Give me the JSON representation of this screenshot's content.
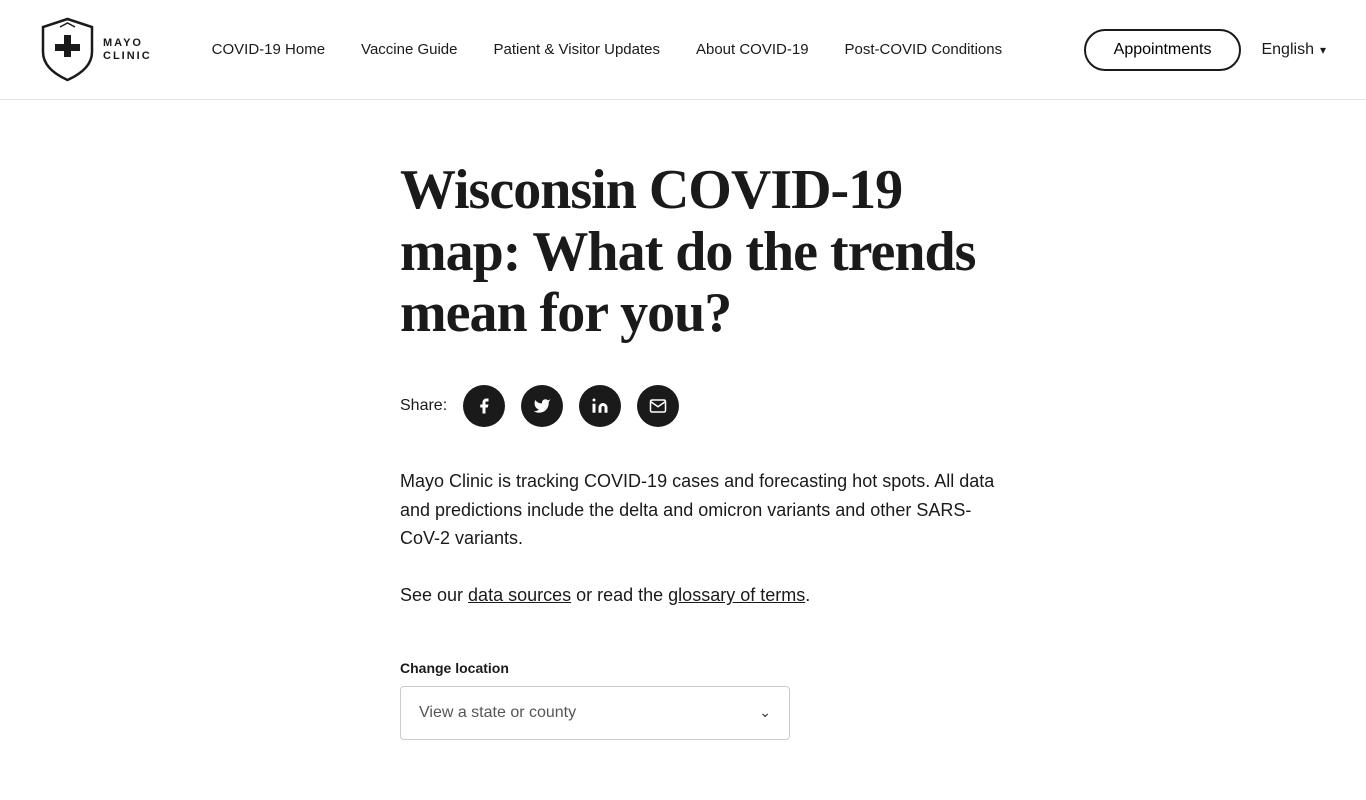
{
  "header": {
    "logo": {
      "line1": "MAYO",
      "line2": "CLINIC"
    },
    "nav": {
      "items": [
        {
          "label": "COVID-19 Home",
          "href": "#"
        },
        {
          "label": "Vaccine Guide",
          "href": "#"
        },
        {
          "label": "Patient & Visitor Updates",
          "href": "#"
        },
        {
          "label": "About COVID-19",
          "href": "#"
        },
        {
          "label": "Post-COVID Conditions",
          "href": "#"
        }
      ]
    },
    "appointments_label": "Appointments",
    "language_label": "English"
  },
  "main": {
    "title": "Wisconsin COVID-19 map: What do the trends mean for you?",
    "share_label": "Share:",
    "share_icons": [
      {
        "name": "facebook",
        "symbol": "f"
      },
      {
        "name": "twitter",
        "symbol": "𝕏"
      },
      {
        "name": "linkedin",
        "symbol": "in"
      },
      {
        "name": "email",
        "symbol": "✉"
      }
    ],
    "description": "Mayo Clinic is tracking COVID-19 cases and forecasting hot spots. All data and predictions include the delta and omicron variants and other SARS-CoV-2 variants.",
    "see_our_prefix": "See our ",
    "data_sources_link": "data sources",
    "see_our_middle": " or read the ",
    "glossary_link": "glossary of terms",
    "see_our_suffix": ".",
    "change_location_label": "Change location",
    "dropdown_placeholder": "View a state or county"
  }
}
